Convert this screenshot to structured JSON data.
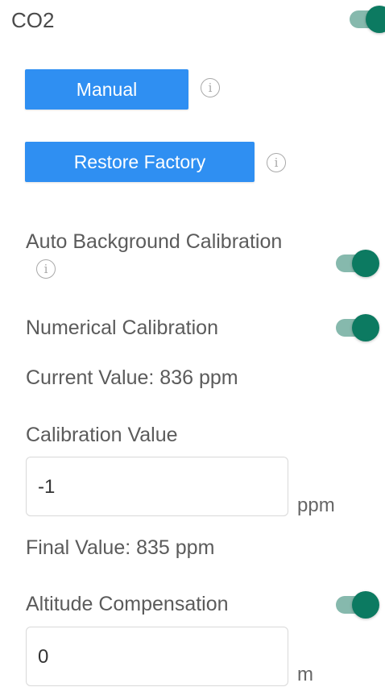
{
  "co2": {
    "title": "CO2",
    "enabled": true
  },
  "buttons": {
    "manual": "Manual",
    "restore_factory": "Restore Factory"
  },
  "auto_background_calibration": {
    "label": "Auto Background Calibration",
    "enabled": true
  },
  "numerical_calibration": {
    "label": "Numerical Calibration",
    "enabled": true
  },
  "current_value": "Current Value: 836 ppm",
  "calibration_value": {
    "label": "Calibration Value",
    "value": "-1",
    "unit": "ppm"
  },
  "final_value": "Final Value: 835 ppm",
  "altitude_compensation": {
    "label": "Altitude Compensation",
    "enabled": true,
    "value": "0",
    "unit": "m"
  },
  "colors": {
    "button_blue": "#2f8ff2",
    "toggle_on_knob": "#0c7a61",
    "toggle_on_track": "#86b9ad"
  },
  "icons": {
    "info": "info-icon"
  }
}
